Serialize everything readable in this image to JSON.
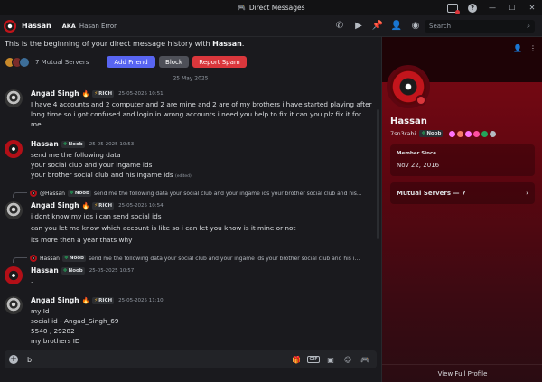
{
  "window": {
    "title": "Direct Messages"
  },
  "header": {
    "name": "Hassan",
    "aka_label": "AKA",
    "aka_value": "Hasan Error",
    "search_placeholder": "Search"
  },
  "intro": {
    "prefix": "This is the beginning of your direct message history with ",
    "name": "Hassan",
    "suffix": "."
  },
  "mutual": {
    "text": "7 Mutual Servers",
    "add_friend": "Add Friend",
    "block": "Block",
    "report_spam": "Report Spam"
  },
  "date_divider": "25 May 2025",
  "messages": [
    {
      "author": "Angad Singh",
      "tag": "RICH",
      "time": "25-05-2025 10:51",
      "lines": [
        "I have 4 accounts and 2 computer and 2 are mine and 2 are of my brothers i have started playing after",
        "long time so i got confused and login in wrong accounts i need you help to fix it can you plz fix it for",
        "me"
      ]
    },
    {
      "author": "Hassan",
      "tag": "Noob",
      "time": "25-05-2025 10:53",
      "lines": [
        "send me the following data",
        "your social club and your ingame ids",
        "your brother social club and his ingame  ids"
      ],
      "edited": "(edited)"
    },
    {
      "reply_name": "@Hassan",
      "reply_tag": "Noob",
      "reply_text": "send me the following data your social club and your ingame ids your brother social club and his...",
      "author": "Angad Singh",
      "tag": "RICH",
      "time": "25-05-2025 10:54",
      "lines": [
        "i dont know my ids i can send social ids",
        "can you let me know which account is like so i can let you know is it mine or not",
        "its more then a year thats why"
      ]
    },
    {
      "reply_name": "Hassan",
      "reply_tag": "Noob",
      "reply_text": "send me the following data your social club and your ingame ids your brother social club and his i...",
      "author": "Hassan",
      "tag": "Noob",
      "time": "25-05-2025 10:57",
      "lines": [
        "."
      ]
    },
    {
      "author": "Angad Singh",
      "tag": "RICH",
      "time": "25-05-2025 11:10",
      "lines": [
        "my Id",
        "social id - Angad_Singh_69",
        "5540 , 29282",
        "my brothers ID"
      ]
    }
  ],
  "composer": {
    "value": "b",
    "gif_label": "GIF"
  },
  "profile": {
    "name": "Hassan",
    "handle": "7sn3rabi",
    "tag": "Noob",
    "member_since_label": "Member Since",
    "member_since_value": "Nov 22, 2016",
    "mutual_servers": "Mutual Servers — 7",
    "view_full": "View Full Profile"
  },
  "colors": {
    "accent": "#5865f2",
    "danger": "#da373c",
    "profile_theme": "#7e0914",
    "status_dnd": "#da373c"
  }
}
